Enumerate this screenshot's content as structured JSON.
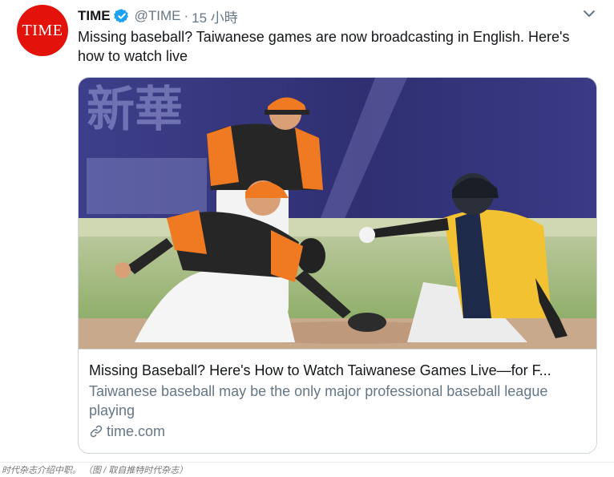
{
  "tweet": {
    "avatar_text": "TIME",
    "author_name": "TIME",
    "handle": "@TIME",
    "separator": "·",
    "timestamp": "15 小時",
    "text": "Missing baseball? Taiwanese games are now broadcasting in English. Here's how to watch live",
    "verified_icon": "verified-badge-icon",
    "menu_icon": "chevron-down-icon"
  },
  "card": {
    "image_sign_text": "新華",
    "title": "Missing Baseball? Here's How to Watch Taiwanese Games Live—for F...",
    "description": "Taiwanese baseball may be the only major professional baseball league playing",
    "domain": "time.com",
    "link_icon": "link-icon"
  },
  "caption": "时代杂志介绍中职。 （图 / 取自推特时代杂志）",
  "colors": {
    "brand_red": "#e3120b",
    "verified_blue": "#1da1f2",
    "secondary_text": "#657786",
    "jersey_orange": "#f07a22",
    "jersey_yellow": "#f2c233"
  }
}
